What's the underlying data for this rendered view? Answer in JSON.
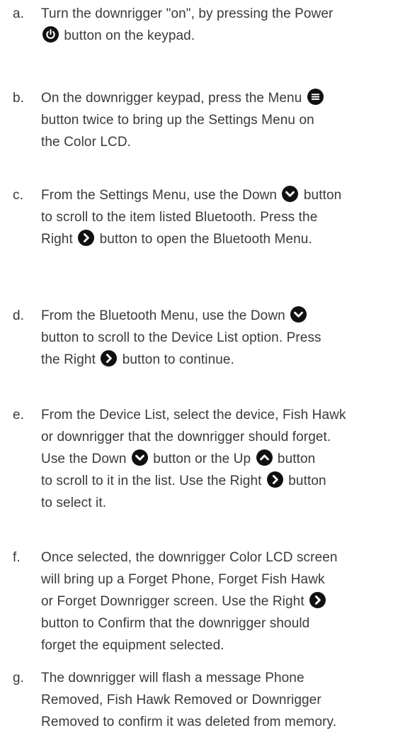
{
  "steps": [
    {
      "letter": "a.",
      "lines": [
        [
          "Turn the downrigger \"on\", by pressing the Power"
        ],
        [
          "",
          {
            "icon": "power-icon"
          },
          " button on the keypad."
        ]
      ]
    },
    {
      "letter": "b.",
      "lines": [
        [
          "On the downrigger keypad, press the Menu ",
          {
            "icon": "menu-icon"
          }
        ],
        [
          "button twice to bring up the Settings Menu on"
        ],
        [
          "the Color LCD."
        ]
      ]
    },
    {
      "letter": "c.",
      "lines": [
        [
          "From the Settings Menu, use the Down ",
          {
            "icon": "chevron-down-icon"
          },
          " button"
        ],
        [
          "to scroll to the item listed Bluetooth. Press the"
        ],
        [
          "Right ",
          {
            "icon": "chevron-right-icon"
          },
          " button to open the Bluetooth Menu."
        ]
      ]
    },
    {
      "letter": "d.",
      "lines": [
        [
          "From the Bluetooth Menu, use the Down ",
          {
            "icon": "chevron-down-icon"
          }
        ],
        [
          "button to scroll to the Device List option. Press"
        ],
        [
          "the Right ",
          {
            "icon": "chevron-right-icon"
          },
          " button to continue."
        ]
      ]
    },
    {
      "letter": "e.",
      "lines": [
        [
          "From the Device List, select the device, Fish Hawk"
        ],
        [
          "or downrigger that the downrigger should forget."
        ],
        [
          "Use the Down ",
          {
            "icon": "chevron-down-icon"
          },
          " button or the Up ",
          {
            "icon": "chevron-up-icon"
          },
          " button"
        ],
        [
          "to scroll to it in the list. Use the Right ",
          {
            "icon": "chevron-right-icon"
          },
          " button"
        ],
        [
          "to select it."
        ]
      ]
    },
    {
      "letter": "f.",
      "lines": [
        [
          "Once selected, the downrigger Color LCD screen"
        ],
        [
          "will bring up a Forget Phone, Forget Fish Hawk"
        ],
        [
          "or Forget Downrigger screen. Use the Right ",
          {
            "icon": "chevron-right-icon"
          }
        ],
        [
          "button to Confirm that the downrigger should"
        ],
        [
          "forget the equipment selected."
        ]
      ]
    },
    {
      "letter": "g.",
      "lines": [
        [
          "The downrigger will flash a message Phone"
        ],
        [
          "Removed, Fish Hawk Removed or Downrigger"
        ],
        [
          "Removed to confirm it was deleted from memory."
        ]
      ]
    }
  ]
}
